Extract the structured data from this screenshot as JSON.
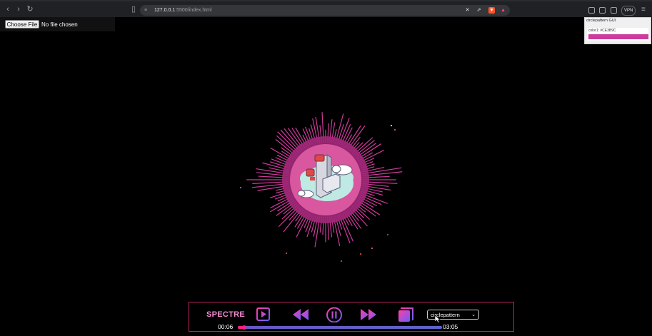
{
  "browser": {
    "url_host": "127.0.0.1",
    "url_rest": ":5500/index.html",
    "vpn_label": "VPN",
    "icons": [
      "back-icon",
      "forward-icon",
      "reload-icon",
      "bookmark-icon",
      "site-settings-icon",
      "brave-shield-icon",
      "brave-rewards-icon",
      "extensions-icon",
      "sidebar-icon",
      "wallet-icon",
      "menu-icon"
    ]
  },
  "file_input": {
    "button_label": "Choose File",
    "status": "No file chosen"
  },
  "gui": {
    "title": "circlepattern GUI",
    "color_label": "color1: #CE3B9C",
    "color_value": "#CE3B9C"
  },
  "player": {
    "brand": "SPECTRE",
    "current_time": "00:06",
    "total_time": "03:05",
    "progress": 0.032,
    "pattern_select": "circlepattern",
    "buttons": [
      "playlist-button",
      "rewind-button",
      "pause-button",
      "fast-forward-button",
      "fullscreen-button"
    ]
  },
  "colors": {
    "accent": "#ce3b9c",
    "player_border": "#c0245f",
    "progress_fill": "#ff1f7d",
    "button_gradient_start": "#ff3fa4",
    "button_gradient_end": "#6a5cff"
  }
}
